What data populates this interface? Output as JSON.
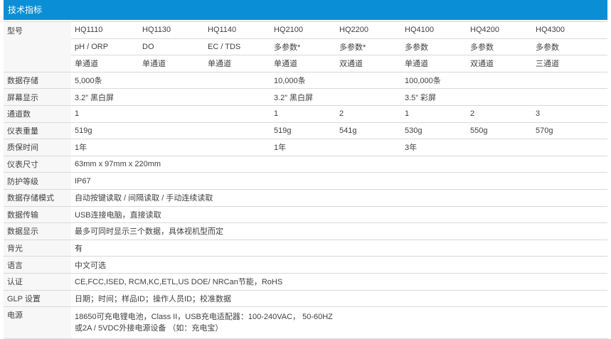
{
  "header": {
    "title": "技术指标"
  },
  "model_header": {
    "label": "型号",
    "models": [
      "HQ1110",
      "HQ1130",
      "HQ1140",
      "HQ2100",
      "HQ2200",
      "HQ4100",
      "HQ4200",
      "HQ4300"
    ],
    "params": [
      "pH / ORP",
      "DO",
      "EC / TDS",
      "多参数*",
      "多参数*",
      "多参数",
      "多参数",
      "多参数"
    ],
    "channels": [
      "单通道",
      "单通道",
      "单通道",
      "单通道",
      "双通道",
      "单通道",
      "双通道",
      "三通道"
    ]
  },
  "rows": {
    "storage": {
      "label": "数据存储",
      "a": "5,000条",
      "b": "10,000条",
      "c": "100,000条"
    },
    "screen": {
      "label": "屏幕显示",
      "a": "3.2” 黑白屏",
      "b": "3.2” 黑白屏",
      "c": "3.5” 彩屏"
    },
    "channels": {
      "label": "通道数",
      "v1": "1",
      "v4": "1",
      "v5": "2",
      "v6": "1",
      "v7": "2",
      "v8": "3"
    },
    "weight": {
      "label": "仪表重量",
      "v1": "519g",
      "v4": "519g",
      "v5": "541g",
      "v6": "530g",
      "v7": "550g",
      "v8": "570g"
    },
    "warranty": {
      "label": "质保时间",
      "a": "1年",
      "b": "1年",
      "c": "3年"
    },
    "size": {
      "label": "仪表尺寸",
      "value": "63mm x 97mm x 220mm"
    },
    "ip": {
      "label": "防护等级",
      "value": "IP67"
    },
    "storage_mode": {
      "label": "数据存储模式",
      "value": "自动按键读取 / 间隔读取 / 手动连续读取"
    },
    "transfer": {
      "label": "数据传输",
      "value": "USB连接电脑，直接读取"
    },
    "display": {
      "label": "数据显示",
      "value": "最多可同时显示三个数据，具体视机型而定"
    },
    "backlight": {
      "label": "背光",
      "value": "有"
    },
    "language": {
      "label": "语言",
      "value": "中文可选"
    },
    "cert": {
      "label": "认证",
      "value": "CE,FCC,ISED, RCM,KC,ETL,US DOE/ NRCan节能，RoHS"
    },
    "glp": {
      "label": "GLP 设置",
      "value": "日期；时间；样品ID；操作人员ID；校准数据"
    },
    "power": {
      "label": "电源",
      "line1": "18650可充电锂电池，Class II，USB充电适配器：100-240VAC， 50-60HZ",
      "line2": "或2A / 5VDC外接电源设备 （如：充电宝）"
    }
  }
}
